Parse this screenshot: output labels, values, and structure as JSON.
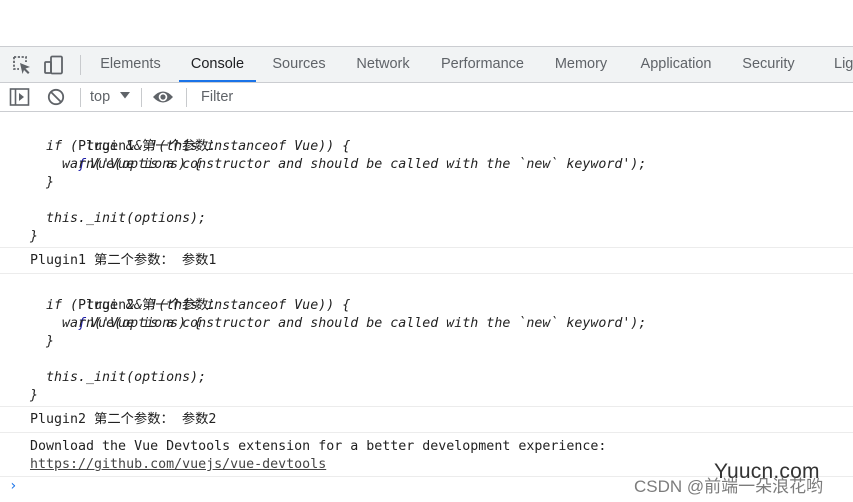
{
  "tabs": [
    {
      "name": "tab-elements",
      "label": "Elements",
      "active": false
    },
    {
      "name": "tab-console",
      "label": "Console",
      "active": true
    },
    {
      "name": "tab-sources",
      "label": "Sources",
      "active": false
    },
    {
      "name": "tab-network",
      "label": "Network",
      "active": false
    },
    {
      "name": "tab-performance",
      "label": "Performance",
      "active": false
    },
    {
      "name": "tab-memory",
      "label": "Memory",
      "active": false
    },
    {
      "name": "tab-application",
      "label": "Application",
      "active": false
    },
    {
      "name": "tab-security",
      "label": "Security",
      "active": false
    },
    {
      "name": "tab-lighthouse",
      "label": "Lig",
      "active": false
    }
  ],
  "toolbar": {
    "context_label": "top",
    "filter_placeholder": "Filter"
  },
  "console": {
    "messages": [
      {
        "label": "Plugin1 第一个参数：",
        "fn_symbol": "ƒ",
        "code_lines": [
          "Vue(options) {",
          "  if ( true && !(this instanceof Vue)) {",
          "    warn('Vue is a constructor and should be called with the `new` keyword');",
          "  }",
          "",
          "  this._init(options);",
          "}"
        ]
      },
      {
        "text": "Plugin1 第二个参数： 参数1"
      },
      {
        "label": "Plugin2 第一个参数：",
        "fn_symbol": "ƒ",
        "code_lines": [
          "Vue(options) {",
          "  if ( true && !(this instanceof Vue)) {",
          "    warn('Vue is a constructor and should be called with the `new` keyword');",
          "  }",
          "",
          "  this._init(options);",
          "}"
        ]
      },
      {
        "text": "Plugin2 第二个参数： 参数2"
      },
      {
        "text": "Download the Vue Devtools extension for a better development experience:",
        "link": "https://github.com/vuejs/vue-devtools"
      }
    ],
    "prompt": "›"
  },
  "watermark": {
    "logo": "Yuucn.com",
    "csdn": "CSDN @前端一朵浪花哟"
  },
  "colors": {
    "accent": "#1a73e8",
    "function_symbol": "#1a1aa6",
    "toolbar_bg": "#f1f3f4"
  }
}
